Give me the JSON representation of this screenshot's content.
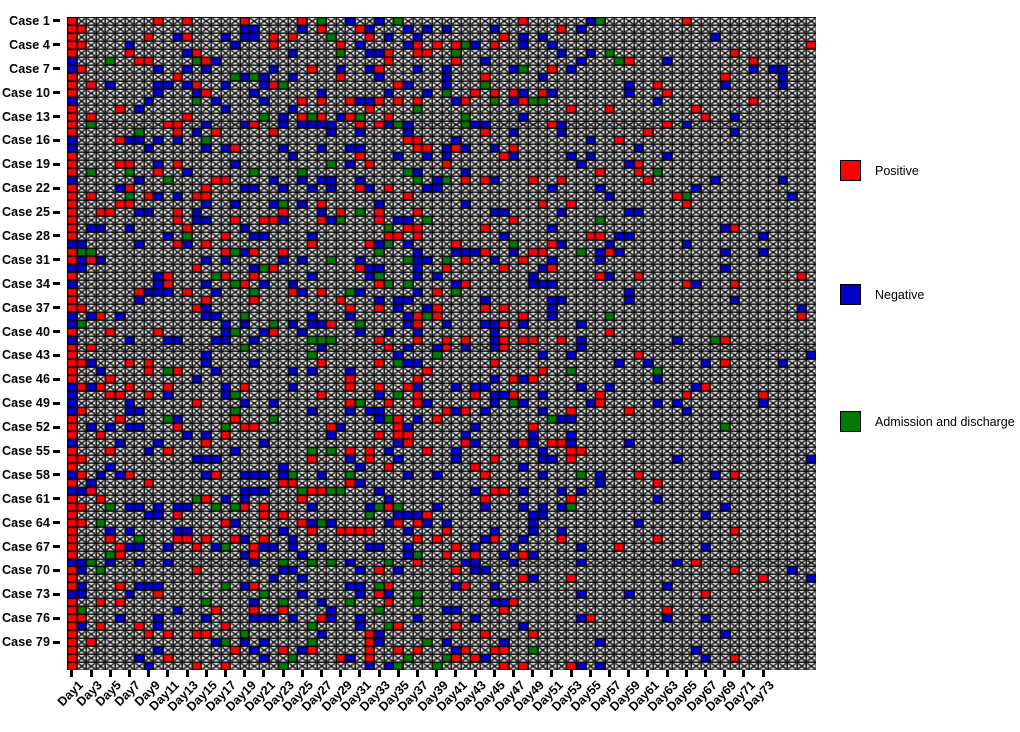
{
  "chart_data": {
    "type": "heatmap",
    "title": "",
    "xlabel": "",
    "ylabel": "",
    "grid": true,
    "legend_position": "right",
    "x_axis": {
      "name": "Day",
      "prefix": "Day",
      "first_day": 1,
      "last_day": 78,
      "n_columns": 78,
      "tick_step": 2,
      "tick_labels": [
        "Day1",
        "Day3",
        "Day5",
        "Day7",
        "Day9",
        "Day11",
        "Day13",
        "Day15",
        "Day17",
        "Day19",
        "Day21",
        "Day23",
        "Day25",
        "Day27",
        "Day29",
        "Day31",
        "Day33",
        "Day35",
        "Day37",
        "Day39",
        "Day41",
        "Day43",
        "Day45",
        "Day47",
        "Day49",
        "Day51",
        "Day53",
        "Day55",
        "Day57",
        "Day59",
        "Day61",
        "Day63",
        "Day65",
        "Day67",
        "Day69",
        "Day71",
        "Day73"
      ]
    },
    "y_axis": {
      "name": "Case",
      "prefix": "Case",
      "first_case": 1,
      "last_case": 82,
      "n_rows": 82,
      "tick_step": 3,
      "tick_labels": [
        "Case 1",
        "Case 4",
        "Case 7",
        "Case 10",
        "Case 13",
        "Case 16",
        "Case 19",
        "Case 22",
        "Case 25",
        "Case 28",
        "Case 31",
        "Case 34",
        "Case 37",
        "Case 40",
        "Case 43",
        "Case 46",
        "Case 49",
        "Case 52",
        "Case 55",
        "Case 58",
        "Case 61",
        "Case 64",
        "Case 67",
        "Case 70",
        "Case 73",
        "Case 76",
        "Case 79"
      ]
    },
    "categories": [
      "empty",
      "positive",
      "negative",
      "admission_discharge"
    ],
    "value_colors": {
      "empty": "#ffffff",
      "positive": "#ff0000",
      "negative": "#0000cc",
      "admission_discharge": "#007a00",
      "border": "#000000"
    },
    "cell_size": {
      "width": 9.6,
      "height": 7.96
    },
    "notes": "Day1 column is fully filled for every case (red or blue); remaining columns are sparsely filled with red, blue and green markers on an X-hatched white background."
  },
  "legend": {
    "items": [
      {
        "label": "Positive",
        "color": "#ff0000",
        "key": "positive"
      },
      {
        "label": "Negative",
        "color": "#0000cc",
        "key": "negative"
      },
      {
        "label": "Admission and discharge",
        "color": "#007a00",
        "key": "admission_discharge"
      }
    ]
  }
}
